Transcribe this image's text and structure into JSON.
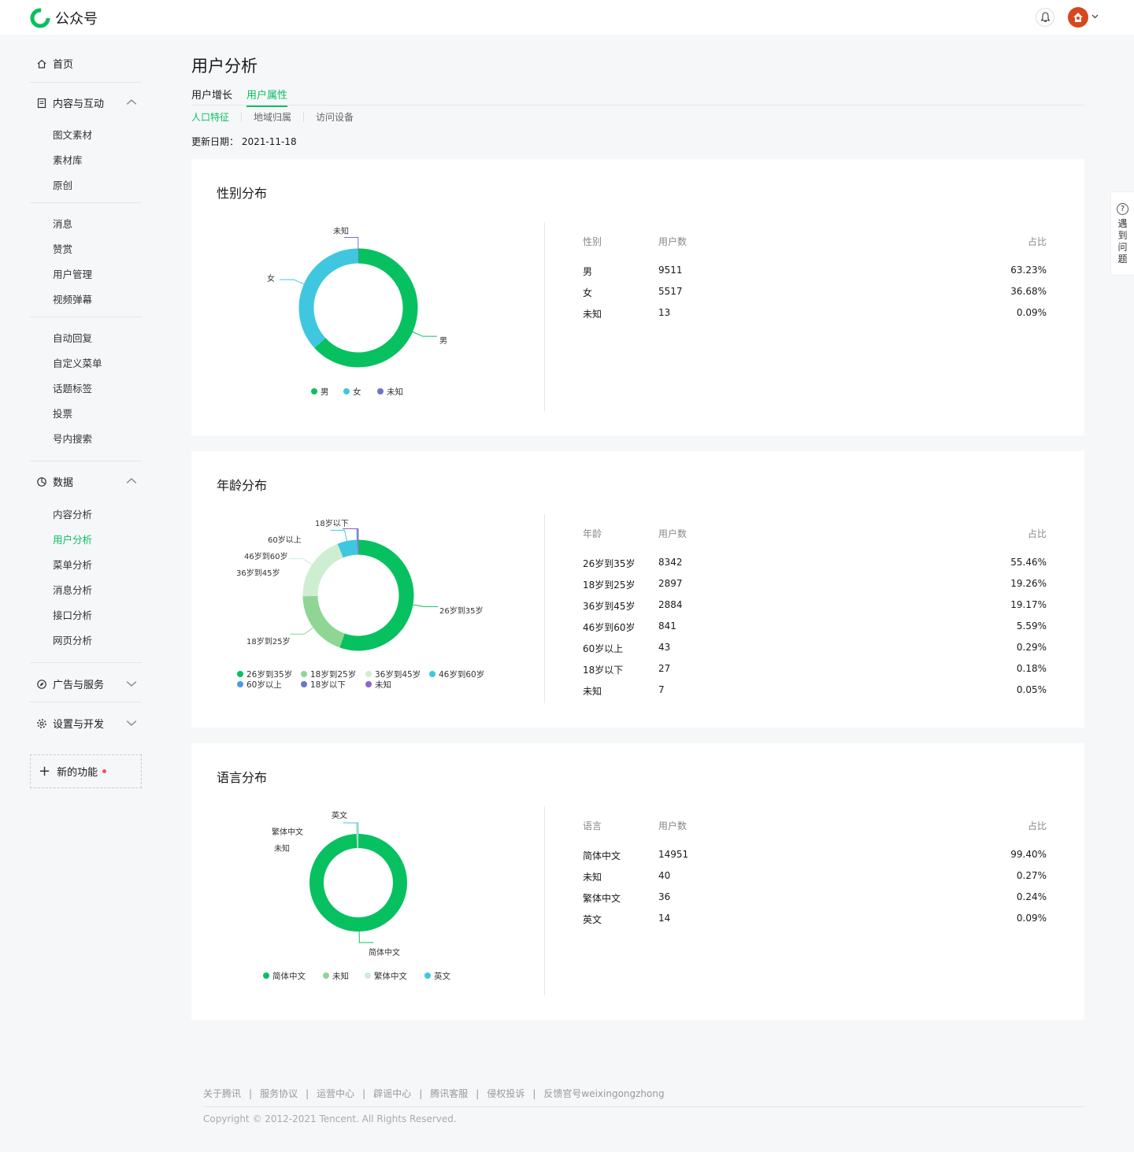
{
  "app": {
    "name": "公众号"
  },
  "nav": {
    "home": "首页",
    "content_group": "内容与互动",
    "content_items": [
      "图文素材",
      "素材库",
      "原创"
    ],
    "message_items": [
      "消息",
      "赞赏",
      "用户管理",
      "视频弹幕"
    ],
    "feature_items": [
      "自动回复",
      "自定义菜单",
      "话题标签",
      "投票",
      "号内搜索"
    ],
    "data_group": "数据",
    "data_items": [
      "内容分析",
      "用户分析",
      "菜单分析",
      "消息分析",
      "接口分析",
      "网页分析"
    ],
    "active_item": "用户分析",
    "ads_group": "广告与服务",
    "settings_group": "设置与开发",
    "new_features": "新的功能"
  },
  "page": {
    "title": "用户分析",
    "tabs": [
      "用户增长",
      "用户属性"
    ],
    "active_tab": "用户属性",
    "subtabs": [
      "人口特征",
      "地域归属",
      "访问设备"
    ],
    "active_subtab": "人口特征",
    "update_label": "更新日期：",
    "update_date": "2021-11-18"
  },
  "help": {
    "label": "遇到问题"
  },
  "colors": {
    "accent": "#07c160",
    "cyan": "#40c7e0",
    "blue_purple": "#6f74c9",
    "light_green": "#8fd694",
    "pale_green": "#cdeed0",
    "blue": "#4a9be6",
    "purple": "#8e63cf"
  },
  "chart_data": [
    {
      "type": "pie",
      "title": "性别分布",
      "table_headers": [
        "性别",
        "用户数",
        "占比"
      ],
      "categories": [
        "男",
        "女",
        "未知"
      ],
      "values": [
        9511,
        5517,
        13
      ],
      "percents": [
        "63.23%",
        "36.68%",
        "0.09%"
      ],
      "legend": [
        "男",
        "女",
        "未知"
      ],
      "colors": [
        "#07c160",
        "#40c7e0",
        "#6f74c9"
      ]
    },
    {
      "type": "pie",
      "title": "年龄分布",
      "table_headers": [
        "年龄",
        "用户数",
        "占比"
      ],
      "categories": [
        "26岁到35岁",
        "18岁到25岁",
        "36岁到45岁",
        "46岁到60岁",
        "60岁以上",
        "18岁以下",
        "未知"
      ],
      "values": [
        8342,
        2897,
        2884,
        841,
        43,
        27,
        7
      ],
      "percents": [
        "55.46%",
        "19.26%",
        "19.17%",
        "5.59%",
        "0.29%",
        "0.18%",
        "0.05%"
      ],
      "legend": [
        "26岁到35岁",
        "18岁到25岁",
        "36岁到45岁",
        "46岁到60岁",
        "60岁以上",
        "18岁以下",
        "未知"
      ],
      "colors": [
        "#07c160",
        "#8fd694",
        "#cdeed0",
        "#40c7e0",
        "#4a9be6",
        "#6f74c9",
        "#8e63cf"
      ]
    },
    {
      "type": "pie",
      "title": "语言分布",
      "table_headers": [
        "语言",
        "用户数",
        "占比"
      ],
      "categories": [
        "简体中文",
        "未知",
        "繁体中文",
        "英文"
      ],
      "values": [
        14951,
        40,
        36,
        14
      ],
      "percents": [
        "99.40%",
        "0.27%",
        "0.24%",
        "0.09%"
      ],
      "legend": [
        "简体中文",
        "未知",
        "繁体中文",
        "英文"
      ],
      "colors": [
        "#07c160",
        "#8fd694",
        "#cdeed0",
        "#40c7e0"
      ]
    }
  ],
  "footer": {
    "links": [
      "关于腾讯",
      "服务协议",
      "运营中心",
      "辟谣中心",
      "腾讯客服",
      "侵权投诉",
      "反馈官号weixingongzhong"
    ],
    "copyright": "Copyright © 2012-2021 Tencent. All Rights Reserved."
  }
}
